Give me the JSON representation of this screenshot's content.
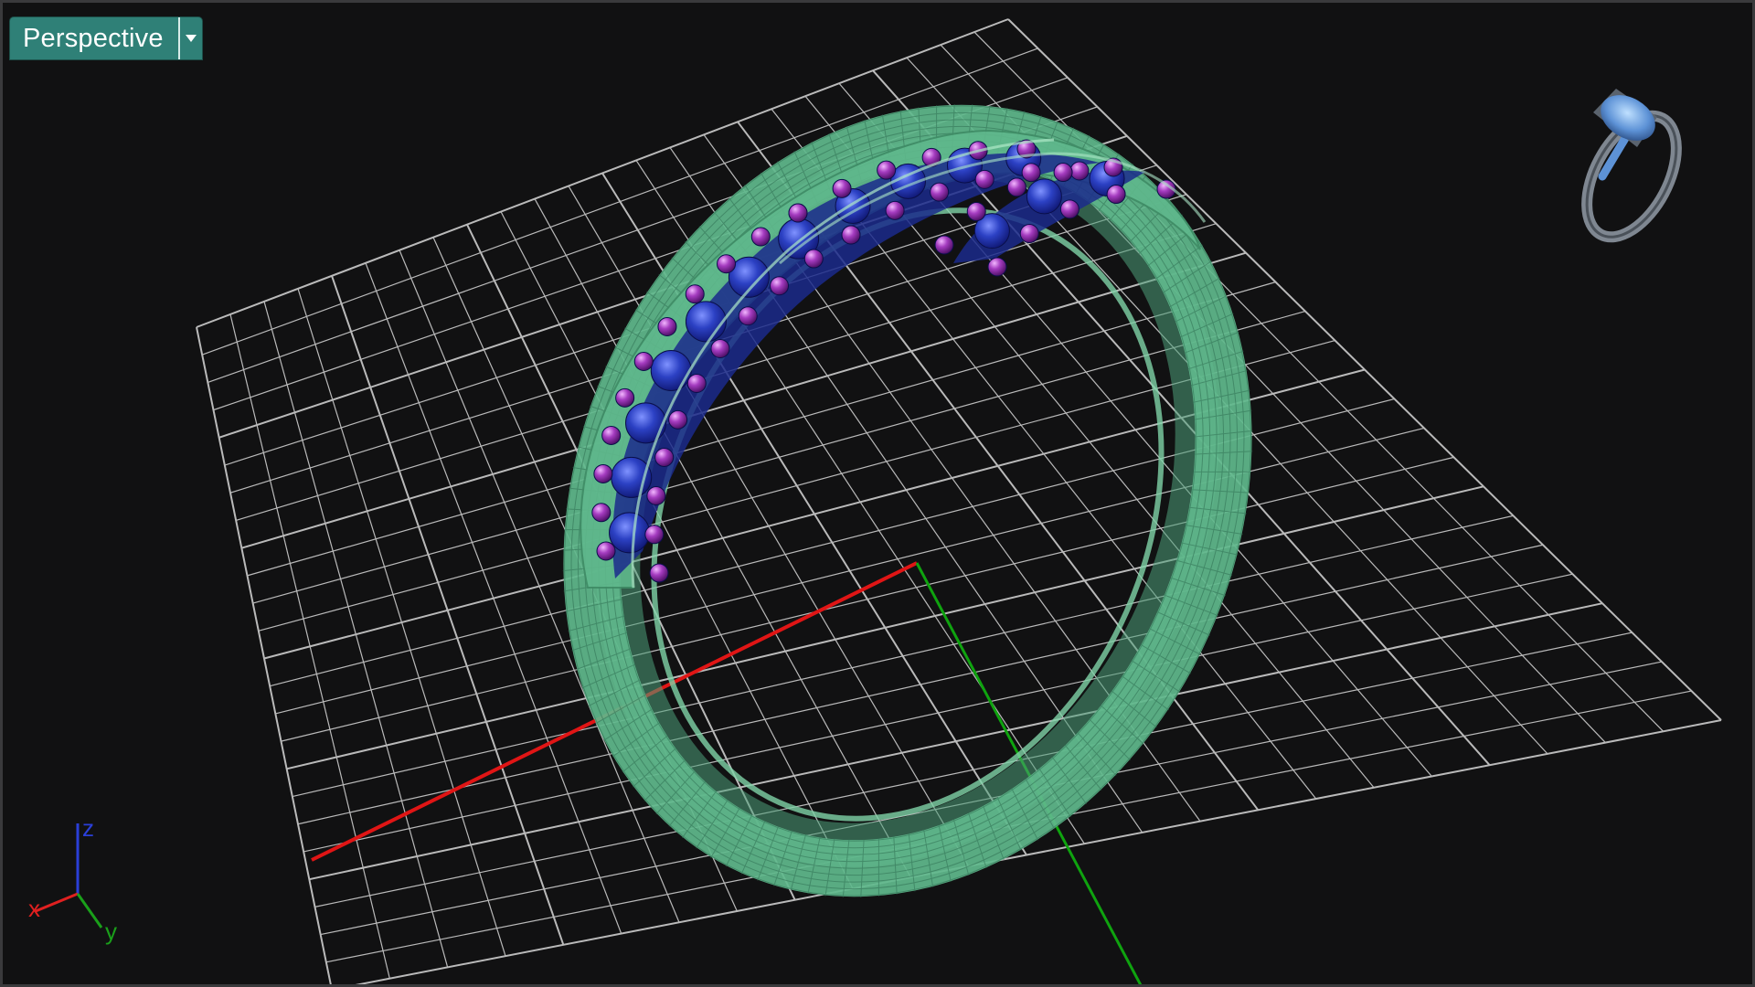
{
  "viewport": {
    "name": "Perspective",
    "menu_icon": "chevron-down-icon"
  },
  "axis_widget": {
    "x_label": "x",
    "y_label": "y",
    "z_label": "z",
    "x_color": "#e02020",
    "y_color": "#1aa01a",
    "z_color": "#2a3fd8"
  },
  "colors": {
    "background": "#111112",
    "grid": "#d8d8d8",
    "world_x_axis": "#e01515",
    "world_y_axis": "#0fa30f",
    "ring_mesh": "#5fb88c",
    "stones_blue": "#2438b8",
    "stones_purple": "#9b2fb6",
    "preview_ring": "#6f8fb8",
    "tab_background": "#2f8077"
  },
  "icons": {
    "preview_thumbnail": "ring-preview-icon",
    "axis_triad": "axis-triad-icon"
  }
}
